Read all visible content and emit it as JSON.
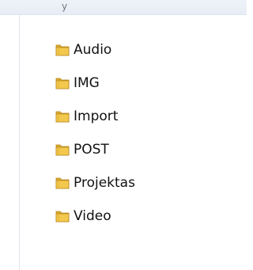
{
  "header": {
    "partial_text": "y"
  },
  "folders": [
    {
      "label": "Audio",
      "icon": "folder-icon"
    },
    {
      "label": "IMG",
      "icon": "folder-icon"
    },
    {
      "label": "Import",
      "icon": "folder-icon"
    },
    {
      "label": "POST",
      "icon": "folder-icon"
    },
    {
      "label": "Projektas",
      "icon": "folder-icon"
    },
    {
      "label": "Video",
      "icon": "folder-icon"
    }
  ],
  "colors": {
    "folder_front": "#f2c94c",
    "folder_back": "#d9a92f",
    "folder_edge": "#b9861f"
  }
}
